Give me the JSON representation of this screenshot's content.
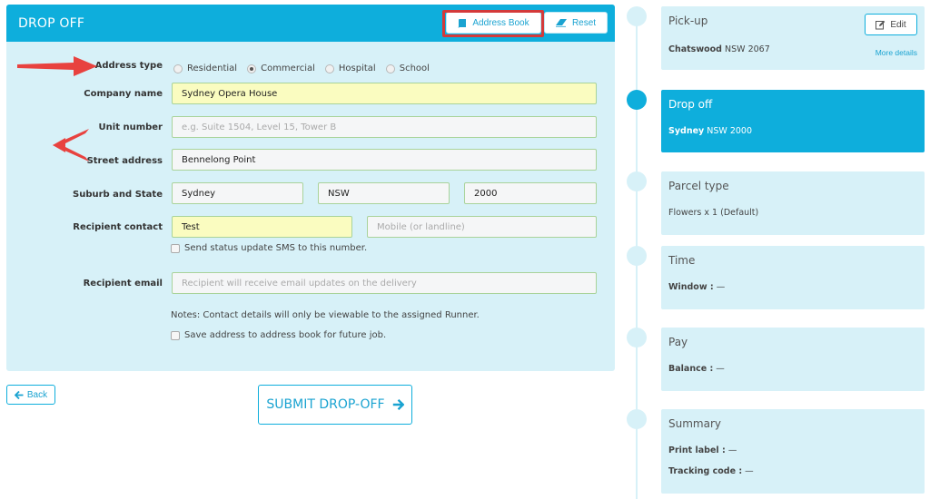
{
  "form": {
    "title": "DROP OFF",
    "address_book_label": "Address Book",
    "reset_label": "Reset",
    "labels": {
      "address_type": "Address type",
      "company_name": "Company name",
      "unit_number": "Unit number",
      "street_address": "Street address",
      "suburb_state": "Suburb and State",
      "recipient_contact": "Recipient contact",
      "recipient_email": "Recipient email"
    },
    "address_types": [
      {
        "label": "Residential",
        "selected": false
      },
      {
        "label": "Commercial",
        "selected": true
      },
      {
        "label": "Hospital",
        "selected": false
      },
      {
        "label": "School",
        "selected": false
      }
    ],
    "company_name_value": "Sydney Opera House",
    "unit_number_placeholder": "e.g. Suite 1504, Level 15, Tower B",
    "street_address_value": "Bennelong Point",
    "suburb_value": "Sydney",
    "state_value": "NSW",
    "postcode_value": "2000",
    "recipient_contact_value": "Test",
    "mobile_placeholder": "Mobile (or landline)",
    "sms_checkbox_label": "Send status update SMS to this number.",
    "email_placeholder": "Recipient will receive email updates on the delivery",
    "note": "Notes: Contact details will only be viewable to the assigned Runner.",
    "save_address_label": "Save address to address book for future job."
  },
  "actions": {
    "back_label": "Back",
    "submit_label": "SUBMIT DROP-OFF"
  },
  "steps": {
    "pickup": {
      "title": "Pick-up",
      "edit_label": "Edit",
      "suburb": "Chatswood",
      "detail": "NSW 2067",
      "more_label": "More details"
    },
    "dropoff": {
      "title": "Drop off",
      "suburb": "Sydney",
      "detail": "NSW 2000"
    },
    "parcel": {
      "title": "Parcel type",
      "detail": "Flowers x 1 (Default)"
    },
    "time": {
      "title": "Time",
      "label": "Window :",
      "value": "—"
    },
    "pay": {
      "title": "Pay",
      "label": "Balance :",
      "value": "—"
    },
    "summary": {
      "title": "Summary",
      "print_label": "Print label :",
      "print_value": "—",
      "tracking_label": "Tracking code :",
      "tracking_value": "—"
    }
  },
  "colors": {
    "brand": "#0eaedc",
    "panel": "#d7f1f8",
    "highlight": "#d43a3a",
    "filled_input": "#fafcc0"
  }
}
